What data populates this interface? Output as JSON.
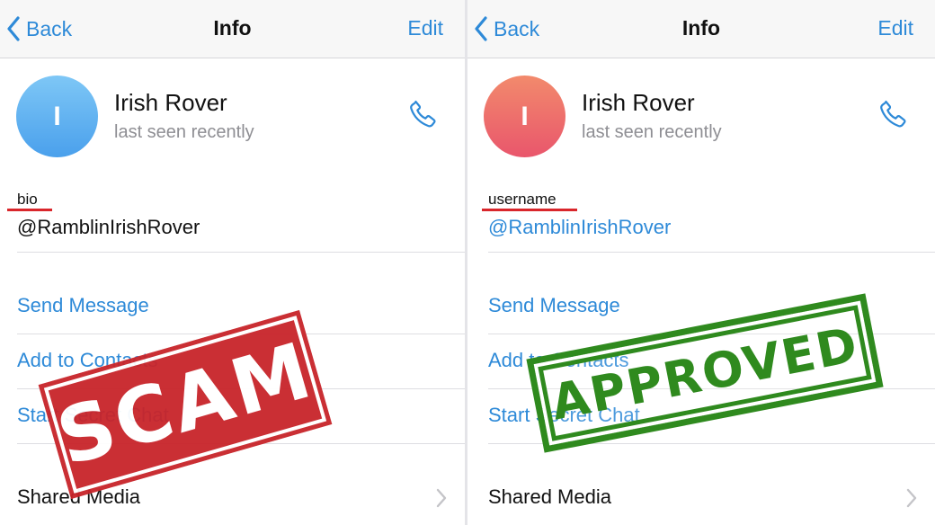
{
  "colors": {
    "accent": "#2e8ad8",
    "underline": "#d9262b",
    "scam": "#c8242a",
    "approved": "#2f8a1e"
  },
  "left": {
    "nav": {
      "back": "Back",
      "title": "Info",
      "edit": "Edit"
    },
    "profile": {
      "initial": "I",
      "name": "Irish Rover",
      "status": "last seen recently"
    },
    "field": {
      "label": "bio",
      "value": "@RamblinIrishRover"
    },
    "actions": [
      "Send Message",
      "Add to Contacts",
      "Start Secret Chat"
    ],
    "shared_media": "Shared Media",
    "stamp": "SCAM"
  },
  "right": {
    "nav": {
      "back": "Back",
      "title": "Info",
      "edit": "Edit"
    },
    "profile": {
      "initial": "I",
      "name": "Irish Rover",
      "status": "last seen recently"
    },
    "field": {
      "label": "username",
      "value": "@RamblinIrishRover"
    },
    "actions": [
      "Send Message",
      "Add to Contacts",
      "Start Secret Chat"
    ],
    "shared_media": "Shared Media",
    "stamp": "APPROVED"
  }
}
